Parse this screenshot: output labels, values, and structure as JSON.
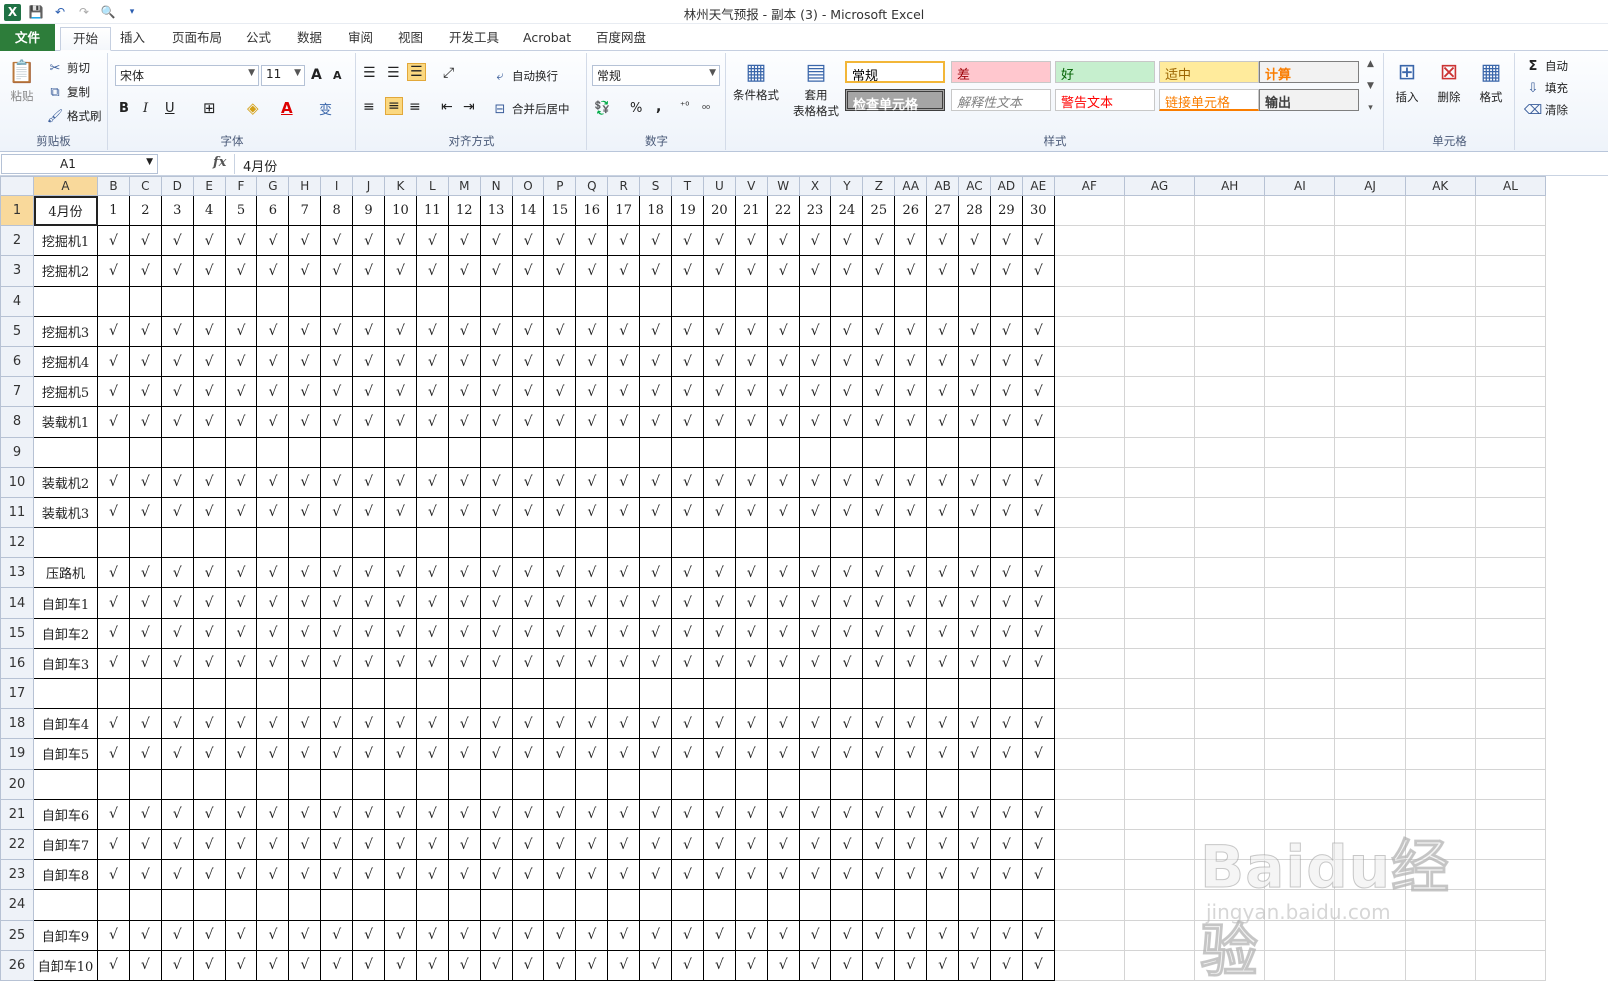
{
  "window": {
    "title": "林州天气预报 - 副本 (3)  -  Microsoft Excel"
  },
  "tabs": [
    "文件",
    "开始",
    "插入",
    "页面布局",
    "公式",
    "数据",
    "审阅",
    "视图",
    "开发工具",
    "Acrobat",
    "百度网盘"
  ],
  "ribbon": {
    "clipboard": {
      "label": "剪贴板",
      "paste": "粘贴",
      "cut": "剪切",
      "copy": "复制",
      "format_painter": "格式刷"
    },
    "font": {
      "label": "字体",
      "name": "宋体",
      "size": "11",
      "grow": "A",
      "shrink": "A",
      "bold": "B",
      "italic": "I",
      "underline": "U",
      "wen": "变"
    },
    "alignment": {
      "label": "对齐方式",
      "wrap": "自动换行",
      "merge": "合并后居中"
    },
    "number": {
      "label": "数字",
      "format": "常规",
      "percent": "%",
      "comma": ","
    },
    "styles": {
      "label": "样式",
      "cond_format": "条件格式",
      "table_format_1": "套用",
      "table_format_2": "表格格式",
      "items": [
        {
          "text": "常规",
          "bg": "#ffffff",
          "color": "#000000"
        },
        {
          "text": "差",
          "bg": "#ffc7ce",
          "color": "#9c0006"
        },
        {
          "text": "好",
          "bg": "#c6efce",
          "color": "#006100"
        },
        {
          "text": "适中",
          "bg": "#ffeb9c",
          "color": "#9c6500"
        },
        {
          "text": "计算",
          "bg": "#f2f2f2",
          "color": "#fa7d00"
        },
        {
          "text": "检查单元格",
          "bg": "#a5a5a5",
          "color": "#ffffff"
        },
        {
          "text": "解释性文本",
          "bg": "#ffffff",
          "color": "#7f7f7f"
        },
        {
          "text": "警告文本",
          "bg": "#ffffff",
          "color": "#ff0000"
        },
        {
          "text": "链接单元格",
          "bg": "#ffffff",
          "color": "#fa7d00"
        },
        {
          "text": "输出",
          "bg": "#f2f2f2",
          "color": "#3f3f3f"
        }
      ]
    },
    "cells": {
      "label": "单元格",
      "insert": "插入",
      "delete": "删除",
      "format": "格式"
    },
    "editing": {
      "autosum": "自动",
      "fill": "填充",
      "clear": "清除"
    }
  },
  "formula_bar": {
    "name_box": "A1",
    "fx": "fx",
    "content": "4月份"
  },
  "sheet": {
    "columns": [
      "A",
      "B",
      "C",
      "D",
      "E",
      "F",
      "G",
      "H",
      "I",
      "J",
      "K",
      "L",
      "M",
      "N",
      "O",
      "P",
      "Q",
      "R",
      "S",
      "T",
      "U",
      "V",
      "W",
      "X",
      "Y",
      "Z",
      "AA",
      "AB",
      "AC",
      "AD",
      "AE",
      "AF",
      "AG",
      "AH",
      "AI",
      "AJ",
      "AK",
      "AL"
    ],
    "header_row": [
      "4月份",
      "1",
      "2",
      "3",
      "4",
      "5",
      "6",
      "7",
      "8",
      "9",
      "10",
      "11",
      "12",
      "13",
      "14",
      "15",
      "16",
      "17",
      "18",
      "19",
      "20",
      "21",
      "22",
      "23",
      "24",
      "25",
      "26",
      "27",
      "28",
      "29",
      "30"
    ],
    "tick": "√",
    "rows": [
      {
        "n": "2",
        "label": "挖掘机1",
        "filled": true
      },
      {
        "n": "3",
        "label": "挖掘机2",
        "filled": true
      },
      {
        "n": "4",
        "label": "",
        "filled": false
      },
      {
        "n": "5",
        "label": "挖掘机3",
        "filled": true
      },
      {
        "n": "6",
        "label": "挖掘机4",
        "filled": true
      },
      {
        "n": "7",
        "label": "挖掘机5",
        "filled": true
      },
      {
        "n": "8",
        "label": "装载机1",
        "filled": true
      },
      {
        "n": "9",
        "label": "",
        "filled": false
      },
      {
        "n": "10",
        "label": "装载机2",
        "filled": true
      },
      {
        "n": "11",
        "label": "装载机3",
        "filled": true
      },
      {
        "n": "12",
        "label": "",
        "filled": false
      },
      {
        "n": "13",
        "label": "压路机",
        "filled": true
      },
      {
        "n": "14",
        "label": "自卸车1",
        "filled": true
      },
      {
        "n": "15",
        "label": "自卸车2",
        "filled": true
      },
      {
        "n": "16",
        "label": "自卸车3",
        "filled": true
      },
      {
        "n": "17",
        "label": "",
        "filled": false
      },
      {
        "n": "18",
        "label": "自卸车4",
        "filled": true
      },
      {
        "n": "19",
        "label": "自卸车5",
        "filled": true
      },
      {
        "n": "20",
        "label": "",
        "filled": false
      },
      {
        "n": "21",
        "label": "自卸车6",
        "filled": true
      },
      {
        "n": "22",
        "label": "自卸车7",
        "filled": true
      },
      {
        "n": "23",
        "label": "自卸车8",
        "filled": true
      },
      {
        "n": "24",
        "label": "",
        "filled": false
      },
      {
        "n": "25",
        "label": "自卸车9",
        "filled": true
      },
      {
        "n": "26",
        "label": "自卸车10",
        "filled": true
      }
    ]
  },
  "watermark": {
    "main": "Baidu经验",
    "sub": "jingyan.baidu.com"
  }
}
